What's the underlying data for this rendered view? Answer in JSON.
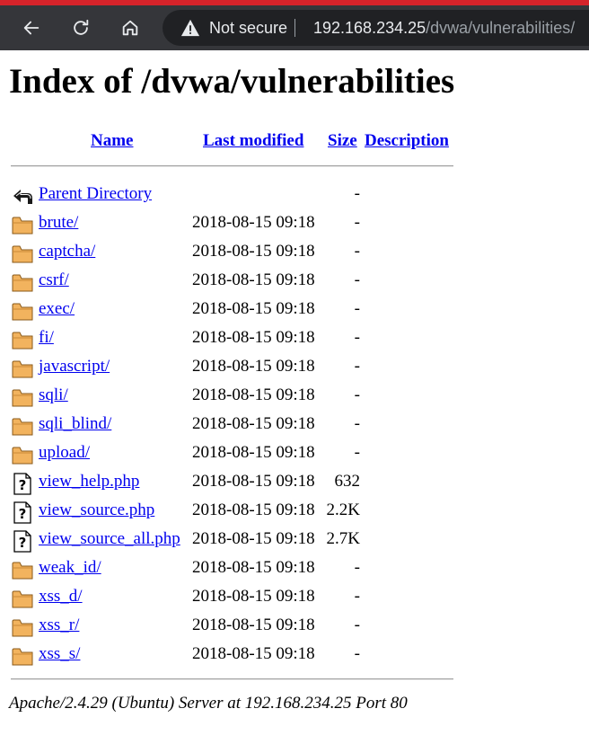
{
  "browser": {
    "security_label": "Not secure",
    "url_host": "192.168.234.25",
    "url_path": "/dvwa/vulnerabilities/",
    "icons": {
      "back": "back-arrow-icon",
      "reload": "reload-icon",
      "home": "home-icon",
      "security": "warning-triangle-icon"
    }
  },
  "page": {
    "title": "Index of /dvwa/vulnerabilities",
    "columns": {
      "name": "Name",
      "last_modified": "Last modified",
      "size": "Size",
      "description": "Description"
    },
    "parent": {
      "name": "Parent Directory",
      "size": "-",
      "icon": "back-folder-icon"
    },
    "entries": [
      {
        "name": "brute/",
        "date": "2018-08-15 09:18",
        "size": "-",
        "icon": "folder-icon"
      },
      {
        "name": "captcha/",
        "date": "2018-08-15 09:18",
        "size": "-",
        "icon": "folder-icon"
      },
      {
        "name": "csrf/",
        "date": "2018-08-15 09:18",
        "size": "-",
        "icon": "folder-icon"
      },
      {
        "name": "exec/",
        "date": "2018-08-15 09:18",
        "size": "-",
        "icon": "folder-icon"
      },
      {
        "name": "fi/",
        "date": "2018-08-15 09:18",
        "size": "-",
        "icon": "folder-icon"
      },
      {
        "name": "javascript/",
        "date": "2018-08-15 09:18",
        "size": "-",
        "icon": "folder-icon"
      },
      {
        "name": "sqli/",
        "date": "2018-08-15 09:18",
        "size": "-",
        "icon": "folder-icon"
      },
      {
        "name": "sqli_blind/",
        "date": "2018-08-15 09:18",
        "size": "-",
        "icon": "folder-icon"
      },
      {
        "name": "upload/",
        "date": "2018-08-15 09:18",
        "size": "-",
        "icon": "folder-icon"
      },
      {
        "name": "view_help.php",
        "date": "2018-08-15 09:18",
        "size": "632",
        "icon": "unknown-file-icon"
      },
      {
        "name": "view_source.php",
        "date": "2018-08-15 09:18",
        "size": "2.2K",
        "icon": "unknown-file-icon"
      },
      {
        "name": "view_source_all.php",
        "date": "2018-08-15 09:18",
        "size": "2.7K",
        "icon": "unknown-file-icon"
      },
      {
        "name": "weak_id/",
        "date": "2018-08-15 09:18",
        "size": "-",
        "icon": "folder-icon"
      },
      {
        "name": "xss_d/",
        "date": "2018-08-15 09:18",
        "size": "-",
        "icon": "folder-icon"
      },
      {
        "name": "xss_r/",
        "date": "2018-08-15 09:18",
        "size": "-",
        "icon": "folder-icon"
      },
      {
        "name": "xss_s/",
        "date": "2018-08-15 09:18",
        "size": "-",
        "icon": "folder-icon"
      }
    ],
    "footer": "Apache/2.4.29 (Ubuntu) Server at 192.168.234.25 Port 80"
  },
  "colors": {
    "link": "#0000ee",
    "chrome_bg": "#35363a",
    "omnibox_bg": "#202124",
    "top_accent": "#d5232a",
    "folder": "#f2b35e"
  }
}
